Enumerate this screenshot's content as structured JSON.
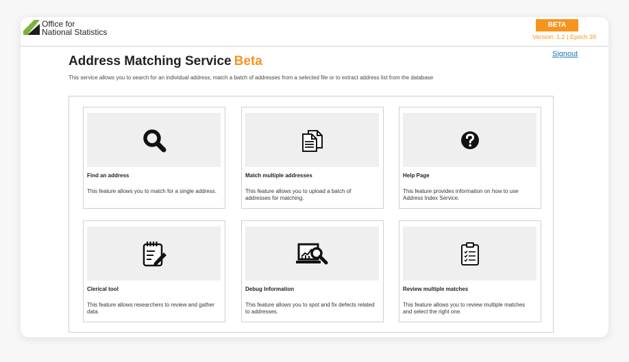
{
  "header": {
    "logo_line1": "Office for",
    "logo_line2": "National Statistics",
    "beta_badge": "BETA",
    "version": "Version: 1.2 | Epoch 39",
    "signout": "Signout"
  },
  "page": {
    "title": "Address Matching Service",
    "title_accent": "Beta",
    "subtitle": "This service allows you to search for an individual address, match a batch of addresses from a selected file or to extract address list from the database"
  },
  "cards": [
    {
      "title": "Find an address",
      "description": "This feature allows you to match for a single address.",
      "icon": "search-icon"
    },
    {
      "title": "Match multiple addresses",
      "description": "This feature allows you to upload a batch of addresses for matching.",
      "icon": "documents-icon"
    },
    {
      "title": "Help Page",
      "description": "This feature provides information on how to use Address Index Service.",
      "icon": "question-circle-icon"
    },
    {
      "title": "Clerical tool",
      "description": "This feature allows researchers to review and gather data.",
      "icon": "notepad-edit-icon"
    },
    {
      "title": "Debug Information",
      "description": "This feature allows you to spot and fix defects related to addresses.",
      "icon": "monitor-search-icon"
    },
    {
      "title": "Review multiple matches",
      "description": "This feature allows you to review multiple matches and select the right one.",
      "icon": "clipboard-checklist-icon"
    }
  ],
  "colors": {
    "accent": "#f7941d",
    "link": "#1f6fbf",
    "logo_dark": "#1d1d1b",
    "logo_green": "#7ab33e"
  }
}
